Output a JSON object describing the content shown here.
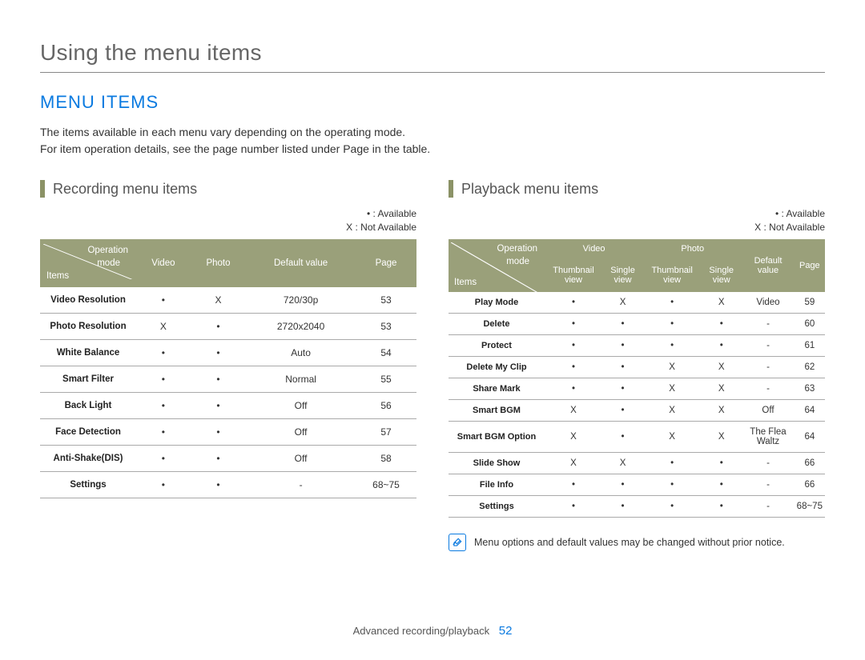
{
  "page_title": "Using the menu items",
  "section_title": "MENU ITEMS",
  "intro_line1": "The items available in each menu vary depending on the operating mode.",
  "intro_line2": "For item operation details, see the page number listed under Page in the table.",
  "legend_available": "• : Available",
  "legend_not_available": "X : Not Available",
  "recording": {
    "title": "Recording menu items",
    "corner": {
      "op": "Operation",
      "mode": "mode",
      "items": "Items"
    },
    "headers": {
      "video": "Video",
      "photo": "Photo",
      "default": "Default value",
      "page": "Page"
    },
    "rows": [
      {
        "item": "Video Resolution",
        "video": "•",
        "photo": "X",
        "default": "720/30p",
        "page": "53"
      },
      {
        "item": "Photo Resolution",
        "video": "X",
        "photo": "•",
        "default": "2720x2040",
        "page": "53"
      },
      {
        "item": "White Balance",
        "video": "•",
        "photo": "•",
        "default": "Auto",
        "page": "54"
      },
      {
        "item": "Smart Filter",
        "video": "•",
        "photo": "•",
        "default": "Normal",
        "page": "55"
      },
      {
        "item": "Back Light",
        "video": "•",
        "photo": "•",
        "default": "Off",
        "page": "56"
      },
      {
        "item": "Face Detection",
        "video": "•",
        "photo": "•",
        "default": "Off",
        "page": "57"
      },
      {
        "item": "Anti-Shake(DIS)",
        "video": "•",
        "photo": "•",
        "default": "Off",
        "page": "58"
      },
      {
        "item": "Settings",
        "video": "•",
        "photo": "•",
        "default": "-",
        "page": "68~75"
      }
    ]
  },
  "playback": {
    "title": "Playback menu items",
    "corner": {
      "op": "Operation",
      "mode": "mode",
      "items": "Items"
    },
    "headers": {
      "video": "Video",
      "photo": "Photo",
      "thumb": "Thumbnail view",
      "single": "Single view",
      "default": "Default value",
      "page": "Page"
    },
    "rows": [
      {
        "item": "Play Mode",
        "vt": "•",
        "vs": "X",
        "pt": "•",
        "ps": "X",
        "default": "Video",
        "page": "59"
      },
      {
        "item": "Delete",
        "vt": "•",
        "vs": "•",
        "pt": "•",
        "ps": "•",
        "default": "-",
        "page": "60"
      },
      {
        "item": "Protect",
        "vt": "•",
        "vs": "•",
        "pt": "•",
        "ps": "•",
        "default": "-",
        "page": "61"
      },
      {
        "item": "Delete My Clip",
        "vt": "•",
        "vs": "•",
        "pt": "X",
        "ps": "X",
        "default": "-",
        "page": "62"
      },
      {
        "item": "Share Mark",
        "vt": "•",
        "vs": "•",
        "pt": "X",
        "ps": "X",
        "default": "-",
        "page": "63"
      },
      {
        "item": "Smart BGM",
        "vt": "X",
        "vs": "•",
        "pt": "X",
        "ps": "X",
        "default": "Off",
        "page": "64"
      },
      {
        "item": "Smart BGM Option",
        "vt": "X",
        "vs": "•",
        "pt": "X",
        "ps": "X",
        "default": "The Flea Waltz",
        "page": "64"
      },
      {
        "item": "Slide Show",
        "vt": "X",
        "vs": "X",
        "pt": "•",
        "ps": "•",
        "default": "-",
        "page": "66"
      },
      {
        "item": "File Info",
        "vt": "•",
        "vs": "•",
        "pt": "•",
        "ps": "•",
        "default": "-",
        "page": "66"
      },
      {
        "item": "Settings",
        "vt": "•",
        "vs": "•",
        "pt": "•",
        "ps": "•",
        "default": "-",
        "page": "68~75"
      }
    ]
  },
  "note_text": "Menu options and default values may be changed without prior notice.",
  "footer_text": "Advanced recording/playback",
  "footer_page": "52",
  "chart_data": [
    {
      "type": "table",
      "title": "Recording menu items",
      "columns": [
        "Items",
        "Video",
        "Photo",
        "Default value",
        "Page"
      ],
      "rows": [
        [
          "Video Resolution",
          "Available",
          "Not Available",
          "720/30p",
          53
        ],
        [
          "Photo Resolution",
          "Not Available",
          "Available",
          "2720x2040",
          53
        ],
        [
          "White Balance",
          "Available",
          "Available",
          "Auto",
          54
        ],
        [
          "Smart Filter",
          "Available",
          "Available",
          "Normal",
          55
        ],
        [
          "Back Light",
          "Available",
          "Available",
          "Off",
          56
        ],
        [
          "Face Detection",
          "Available",
          "Available",
          "Off",
          57
        ],
        [
          "Anti-Shake(DIS)",
          "Available",
          "Available",
          "Off",
          58
        ],
        [
          "Settings",
          "Available",
          "Available",
          "-",
          "68~75"
        ]
      ]
    },
    {
      "type": "table",
      "title": "Playback menu items",
      "columns": [
        "Items",
        "Video Thumbnail view",
        "Video Single view",
        "Photo Thumbnail view",
        "Photo Single view",
        "Default value",
        "Page"
      ],
      "rows": [
        [
          "Play Mode",
          "Available",
          "Not Available",
          "Available",
          "Not Available",
          "Video",
          59
        ],
        [
          "Delete",
          "Available",
          "Available",
          "Available",
          "Available",
          "-",
          60
        ],
        [
          "Protect",
          "Available",
          "Available",
          "Available",
          "Available",
          "-",
          61
        ],
        [
          "Delete My Clip",
          "Available",
          "Available",
          "Not Available",
          "Not Available",
          "-",
          62
        ],
        [
          "Share Mark",
          "Available",
          "Available",
          "Not Available",
          "Not Available",
          "-",
          63
        ],
        [
          "Smart BGM",
          "Not Available",
          "Available",
          "Not Available",
          "Not Available",
          "Off",
          64
        ],
        [
          "Smart BGM Option",
          "Not Available",
          "Available",
          "Not Available",
          "Not Available",
          "The Flea Waltz",
          64
        ],
        [
          "Slide Show",
          "Not Available",
          "Not Available",
          "Available",
          "Available",
          "-",
          66
        ],
        [
          "File Info",
          "Available",
          "Available",
          "Available",
          "Available",
          "-",
          66
        ],
        [
          "Settings",
          "Available",
          "Available",
          "Available",
          "Available",
          "-",
          "68~75"
        ]
      ]
    }
  ]
}
